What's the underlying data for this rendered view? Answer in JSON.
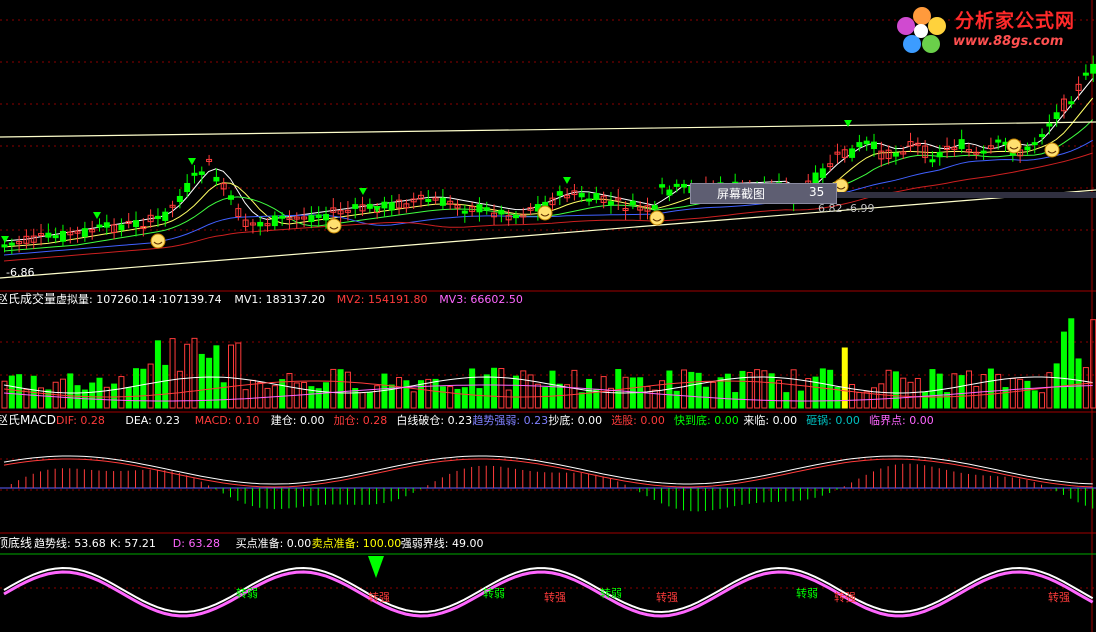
{
  "colors": {
    "bg": "#000000",
    "up": "#ff3b3b",
    "down": "#00ff00",
    "white": "#ffffff",
    "yellow": "#ffff00",
    "magenta": "#ff66ff",
    "blue": "#4060ff",
    "cyan": "#00c0c0",
    "grid": "#8b0000"
  },
  "logo": {
    "title": "分析家公式网",
    "url": "www.88gs.com",
    "icon": "flower-logo-icon"
  },
  "tooltip": {
    "label": "屏幕截图",
    "number": "35"
  },
  "price_panel": {
    "low_label": "-6.86",
    "right_labels": "6.82 -6.99"
  },
  "volume_panel": {
    "name": "赵氏成交量",
    "items": [
      {
        "label": "虚拟量: 107260.14",
        "color": "#ffffff"
      },
      {
        "label": ":107139.74",
        "color": "#ffffff"
      },
      {
        "label": "MV1: 183137.20",
        "color": "#ffffff"
      },
      {
        "label": "MV2: 154191.80",
        "color": "#ff3b3b"
      },
      {
        "label": "MV3: 66602.50",
        "color": "#ff66ff"
      }
    ]
  },
  "macd_panel": {
    "name": "赵氏MACD",
    "items": [
      {
        "label": "DIF: 0.28",
        "color": "#ff3b3b"
      },
      {
        "label": "DEA: 0.23",
        "color": "#ffffff"
      },
      {
        "label": "MACD: 0.10",
        "color": "#ff3b3b"
      },
      {
        "label": "建仓: 0.00",
        "color": "#ffffff"
      },
      {
        "label": "加仓: 0.28",
        "color": "#ff3b3b"
      },
      {
        "label": "白线破仓: 0.23",
        "color": "#ffffff"
      },
      {
        "label": "趋势强弱: 0.23",
        "color": "#8080ff"
      },
      {
        "label": "抄底: 0.00",
        "color": "#ffffff"
      },
      {
        "label": "选股: 0.00",
        "color": "#ff3b3b"
      },
      {
        "label": "快到底: 0.00",
        "color": "#00ff00"
      },
      {
        "label": "来临: 0.00",
        "color": "#ffffff"
      },
      {
        "label": "砸锅: 0.00",
        "color": "#00c0c0"
      },
      {
        "label": "临界点: 0.00",
        "color": "#ff66ff"
      }
    ]
  },
  "kdj_panel": {
    "name": "顶底线",
    "items": [
      {
        "label": "趋势线: 53.68",
        "color": "#ffffff"
      },
      {
        "label": "K: 57.21",
        "color": "#ffffff"
      },
      {
        "label": "D: 63.28",
        "color": "#ff66ff"
      },
      {
        "label": "买点准备: 0.00",
        "color": "#ffffff"
      },
      {
        "label": "卖点准备: 100.00",
        "color": "#ffff00"
      },
      {
        "label": "强弱界线: 49.00",
        "color": "#ffffff"
      }
    ],
    "signals": [
      {
        "text": "转弱",
        "kind": "weak"
      },
      {
        "text": "转强",
        "kind": "strong"
      },
      {
        "text": "转弱",
        "kind": "weak"
      },
      {
        "text": "转强",
        "kind": "strong"
      },
      {
        "text": "转弱",
        "kind": "weak"
      },
      {
        "text": "转强",
        "kind": "strong"
      },
      {
        "text": "转弱",
        "kind": "weak"
      },
      {
        "text": "转强",
        "kind": "strong"
      },
      {
        "text": "转强",
        "kind": "strong"
      }
    ]
  }
}
